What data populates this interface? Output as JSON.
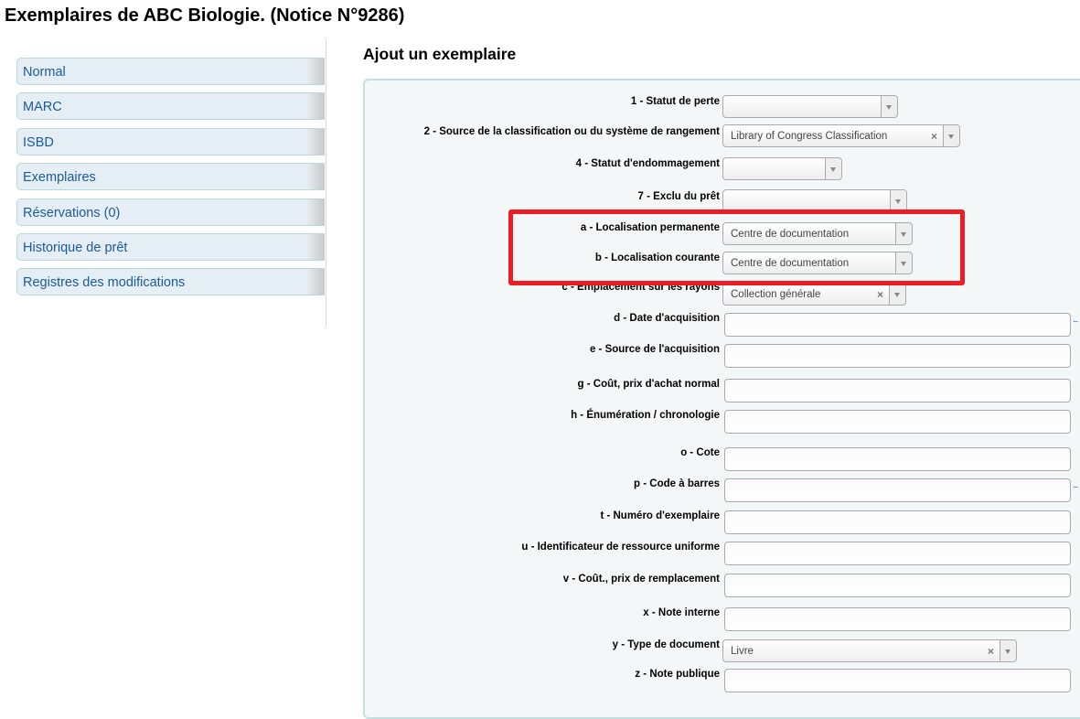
{
  "page_title": "Exemplaires de ABC Biologie. (Notice N°9286)",
  "sidebar": {
    "items": [
      {
        "label": "Normal"
      },
      {
        "label": "MARC"
      },
      {
        "label": "ISBD"
      },
      {
        "label": "Exemplaires"
      },
      {
        "label": "Réservations (0)"
      },
      {
        "label": "Historique de prêt"
      },
      {
        "label": "Registres des modifications"
      }
    ]
  },
  "form": {
    "title": "Ajout un exemplaire",
    "fields": {
      "f1": {
        "label": "1 - Statut de perte",
        "value": ""
      },
      "f2": {
        "label": "2 - Source de la classification ou du système de rangement",
        "value": "Library of Congress Classification"
      },
      "f4": {
        "label": "4 - Statut d'endommagement",
        "value": ""
      },
      "f7": {
        "label": "7 - Exclu du prêt",
        "value": ""
      },
      "fa": {
        "label": "a - Localisation permanente",
        "value": "Centre de documentation"
      },
      "fb": {
        "label": "b - Localisation courante",
        "value": "Centre de documentation"
      },
      "fc": {
        "label": "c - Emplacement sur les rayons",
        "value": "Collection générale"
      },
      "fd": {
        "label": "d - Date d'acquisition",
        "value": ""
      },
      "fe": {
        "label": "e - Source de l'acquisition",
        "value": ""
      },
      "fg": {
        "label": "g - Coût, prix d'achat normal",
        "value": ""
      },
      "fh": {
        "label": "h - Énumération / chronologie",
        "value": ""
      },
      "fo": {
        "label": "o - Cote",
        "value": ""
      },
      "fp": {
        "label": "p - Code à barres",
        "value": ""
      },
      "ft": {
        "label": "t - Numéro d'exemplaire",
        "value": ""
      },
      "fu": {
        "label": "u - Identificateur de ressource uniforme",
        "value": ""
      },
      "fv": {
        "label": "v - Coût., prix de remplacement",
        "value": ""
      },
      "fx": {
        "label": "x - Note interne",
        "value": ""
      },
      "fy": {
        "label": "y - Type de document",
        "value": "Livre"
      },
      "fz": {
        "label": "z - Note publique",
        "value": ""
      }
    },
    "plugin_link": "...",
    "clear_icon": "×"
  },
  "colors": {
    "highlight": "#ee1c25",
    "link": "#1a5a9a"
  }
}
